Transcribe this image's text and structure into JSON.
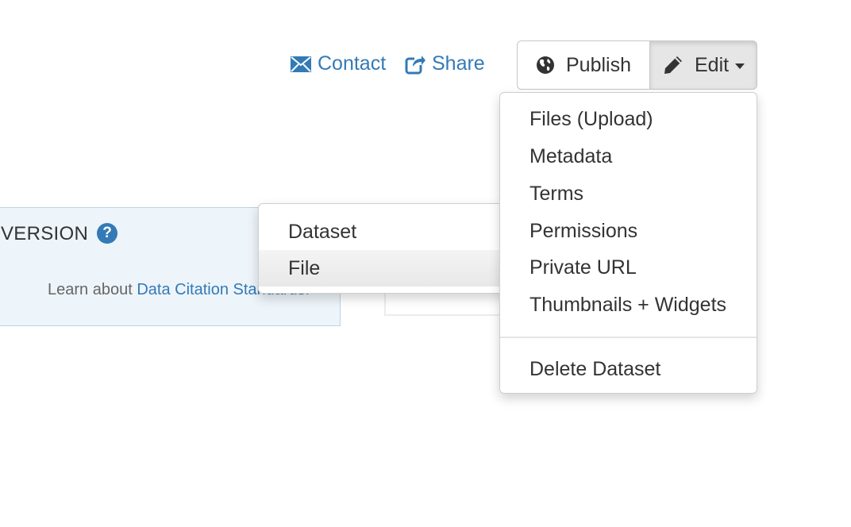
{
  "header": {
    "contact_label": "Contact",
    "share_label": "Share",
    "publish_label": "Publish",
    "edit_label": "Edit"
  },
  "edit_menu": {
    "items": [
      {
        "label": "Files (Upload)"
      },
      {
        "label": "Metadata"
      },
      {
        "label": "Terms"
      },
      {
        "label": "Permissions"
      },
      {
        "label": "Private URL"
      },
      {
        "label": "Thumbnails + Widgets"
      },
      {
        "label": "Delete Dataset"
      }
    ]
  },
  "sub_menu": {
    "items": [
      {
        "label": "Dataset"
      },
      {
        "label": "File"
      }
    ]
  },
  "citation": {
    "title": "VERSION",
    "help_symbol": "?",
    "learn_prefix": "Learn about ",
    "learn_link": "Data Citation Standards."
  },
  "colors": {
    "link": "#337ab7",
    "citation_bg": "#edf4fa",
    "active_item": "#e8e8e8"
  },
  "icons": {
    "contact": "envelope-icon",
    "share": "share-icon",
    "publish": "globe-icon",
    "edit": "pencil-icon",
    "help": "question-circle-icon"
  }
}
